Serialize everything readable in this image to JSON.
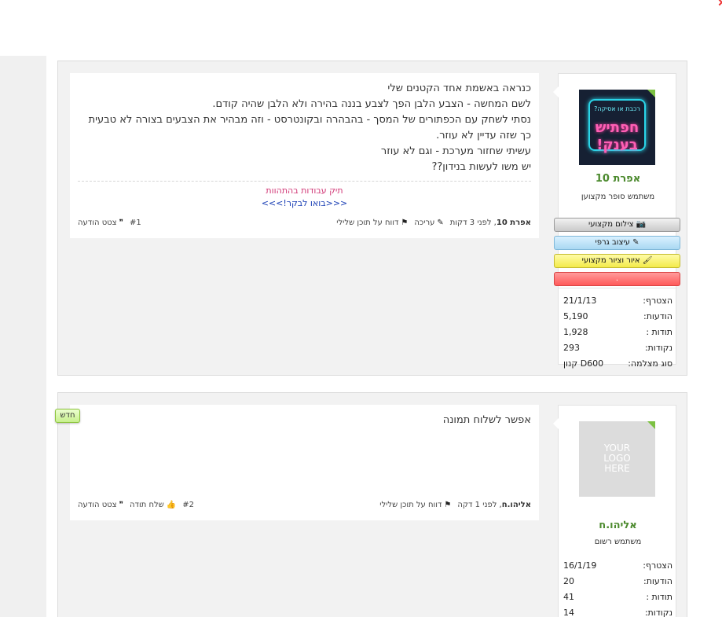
{
  "posts": [
    {
      "number": "#1",
      "author": {
        "avatar_top_text": "רכבת או אסיקה?",
        "avatar_main_text": "חפתיש בענק!",
        "name": "אפרת 10",
        "title": "משתמש סופר מקצוען",
        "badges": [
          {
            "label": "צילום מקצועי",
            "icon": "camera-icon"
          },
          {
            "label": "עיצוב גרפי",
            "icon": "pencil-icon"
          },
          {
            "label": "איור וציור מקצועי",
            "icon": "brush-icon"
          },
          {
            "label": "."
          }
        ],
        "stats": [
          {
            "label": "הצטרף:",
            "value": "21/1/13"
          },
          {
            "label": "הודעות:",
            "value": "5,190"
          },
          {
            "label": "תודות :",
            "value": "1,928"
          },
          {
            "label": "נקודות:",
            "value": "293"
          },
          {
            "label": "סוג מצלמה:",
            "value": "D600 קנון"
          }
        ]
      },
      "lines": [
        "כנראה באשמת אחד הקטנים שלי",
        "לשם המחשה - הצבע הלבן הפך לצבע בננה בהירה ולא הלבן שהיה קודם.",
        "נסתי לשחק עם הכפתורים של המסך - בהבהרה ובקונטרסט - וזה מבהיר את הצבעים בצורה לא טבעית",
        "כך שזה עדיין לא עוזר.",
        "עשיתי שחזור מערכת - וגם לא עוזר",
        "יש משו לעשות בנידון??"
      ],
      "signature": {
        "line1": "תיק עבודות בהתהוות",
        "line2": "<<<בואו לבקר!>>>"
      },
      "footer": {
        "meta_author": "אפרת 10",
        "meta_time": ", לפני 3 דקות",
        "edit": "עריכה",
        "report": "דווח על תוכן שלילי",
        "quote": "צטט הודעה"
      }
    },
    {
      "number": "#2",
      "new_label": "חדש",
      "author": {
        "avatar_text": "YOUR\nLOGO\nHERE",
        "name": "אליהו.ח",
        "title": "משתמש רשום",
        "stats": [
          {
            "label": "הצטרף:",
            "value": "16/1/19"
          },
          {
            "label": "הודעות:",
            "value": "20"
          },
          {
            "label": "תודות :",
            "value": "41"
          },
          {
            "label": "נקודות:",
            "value": "14"
          }
        ]
      },
      "lines": [
        "אפשר לשלוח תמונה"
      ],
      "footer": {
        "meta_author": "אליהו.ח",
        "meta_time": ", לפני 1 דקה",
        "report": "דווח על תוכן שלילי",
        "thanks": "שלח תודה",
        "quote": "צטט הודעה"
      }
    }
  ]
}
